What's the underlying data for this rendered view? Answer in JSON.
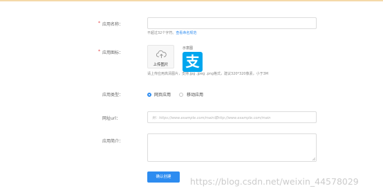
{
  "form": {
    "app_name": {
      "label": "应用名称：",
      "value": "",
      "hint_prefix": "不超过32个字符。",
      "hint_link": "查看命名规范"
    },
    "app_icon": {
      "label": "应用图标：",
      "upload_label": "上传图片",
      "sample_label": "示意图",
      "sample_glyph": "支",
      "hint": "请上传应用高清图片，支持.jpg .jpeg .png格式，建议320*320像素，小于3M"
    },
    "app_type": {
      "label": "应用类型：",
      "options": [
        {
          "label": "网页应用",
          "checked": true
        },
        {
          "label": "移动应用",
          "checked": false
        }
      ]
    },
    "url": {
      "label": "网址url：",
      "value": "",
      "placeholder": "例：https://www.example.com/main或http://www.example.com/main"
    },
    "intro": {
      "label": "应用简介：",
      "value": ""
    },
    "submit_label": "确认创建"
  },
  "watermark": "https://blog.csdn.net/weixin_44578029",
  "colors": {
    "primary": "#2d8cf0",
    "required": "#e4393c",
    "sample_logo": "#00a6ee",
    "top_border": "#f5d9a8"
  }
}
